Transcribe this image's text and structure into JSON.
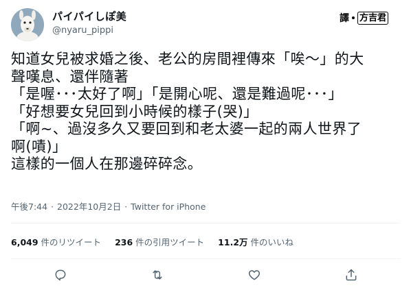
{
  "user": {
    "display_name": "パイパイしぽ美",
    "handle": "@nyaru_pippi",
    "avatar_icon": "llama-avatar-icon"
  },
  "watermark": {
    "prefix": "譯",
    "name": "方吉君"
  },
  "tweet": {
    "lines": [
      "知道女兒被求婚之後、老公的房間裡傳來「唉～」的大",
      "聲嘆息、還伴隨著",
      "「是喔･･･太好了啊」「是開心呢、還是難過呢･･･」",
      "「好想要女兒回到小時候的樣子(哭)」",
      "「啊~、過沒多久又要回到和老太婆一起的兩人世界了",
      "啊(嘖)」",
      "這樣的一個人在那邊碎碎念。"
    ]
  },
  "meta": {
    "time": "午後7:44",
    "separator": "·",
    "date": "2022年10月2日",
    "source": "Twitter for iPhone"
  },
  "stats": {
    "retweets_count": "6,049",
    "retweets_label": "件のリツイート",
    "quotes_count": "236",
    "quotes_label": "件の引用ツイート",
    "likes_count": "11.2万",
    "likes_label": "件のいいね"
  },
  "actions": {
    "reply_icon": "comment-icon",
    "retweet_icon": "retweet-icon",
    "like_icon": "heart-icon",
    "share_icon": "share-icon"
  },
  "colors": {
    "text": "#0f1419",
    "secondary": "#536471",
    "divider": "#eff3f4"
  }
}
